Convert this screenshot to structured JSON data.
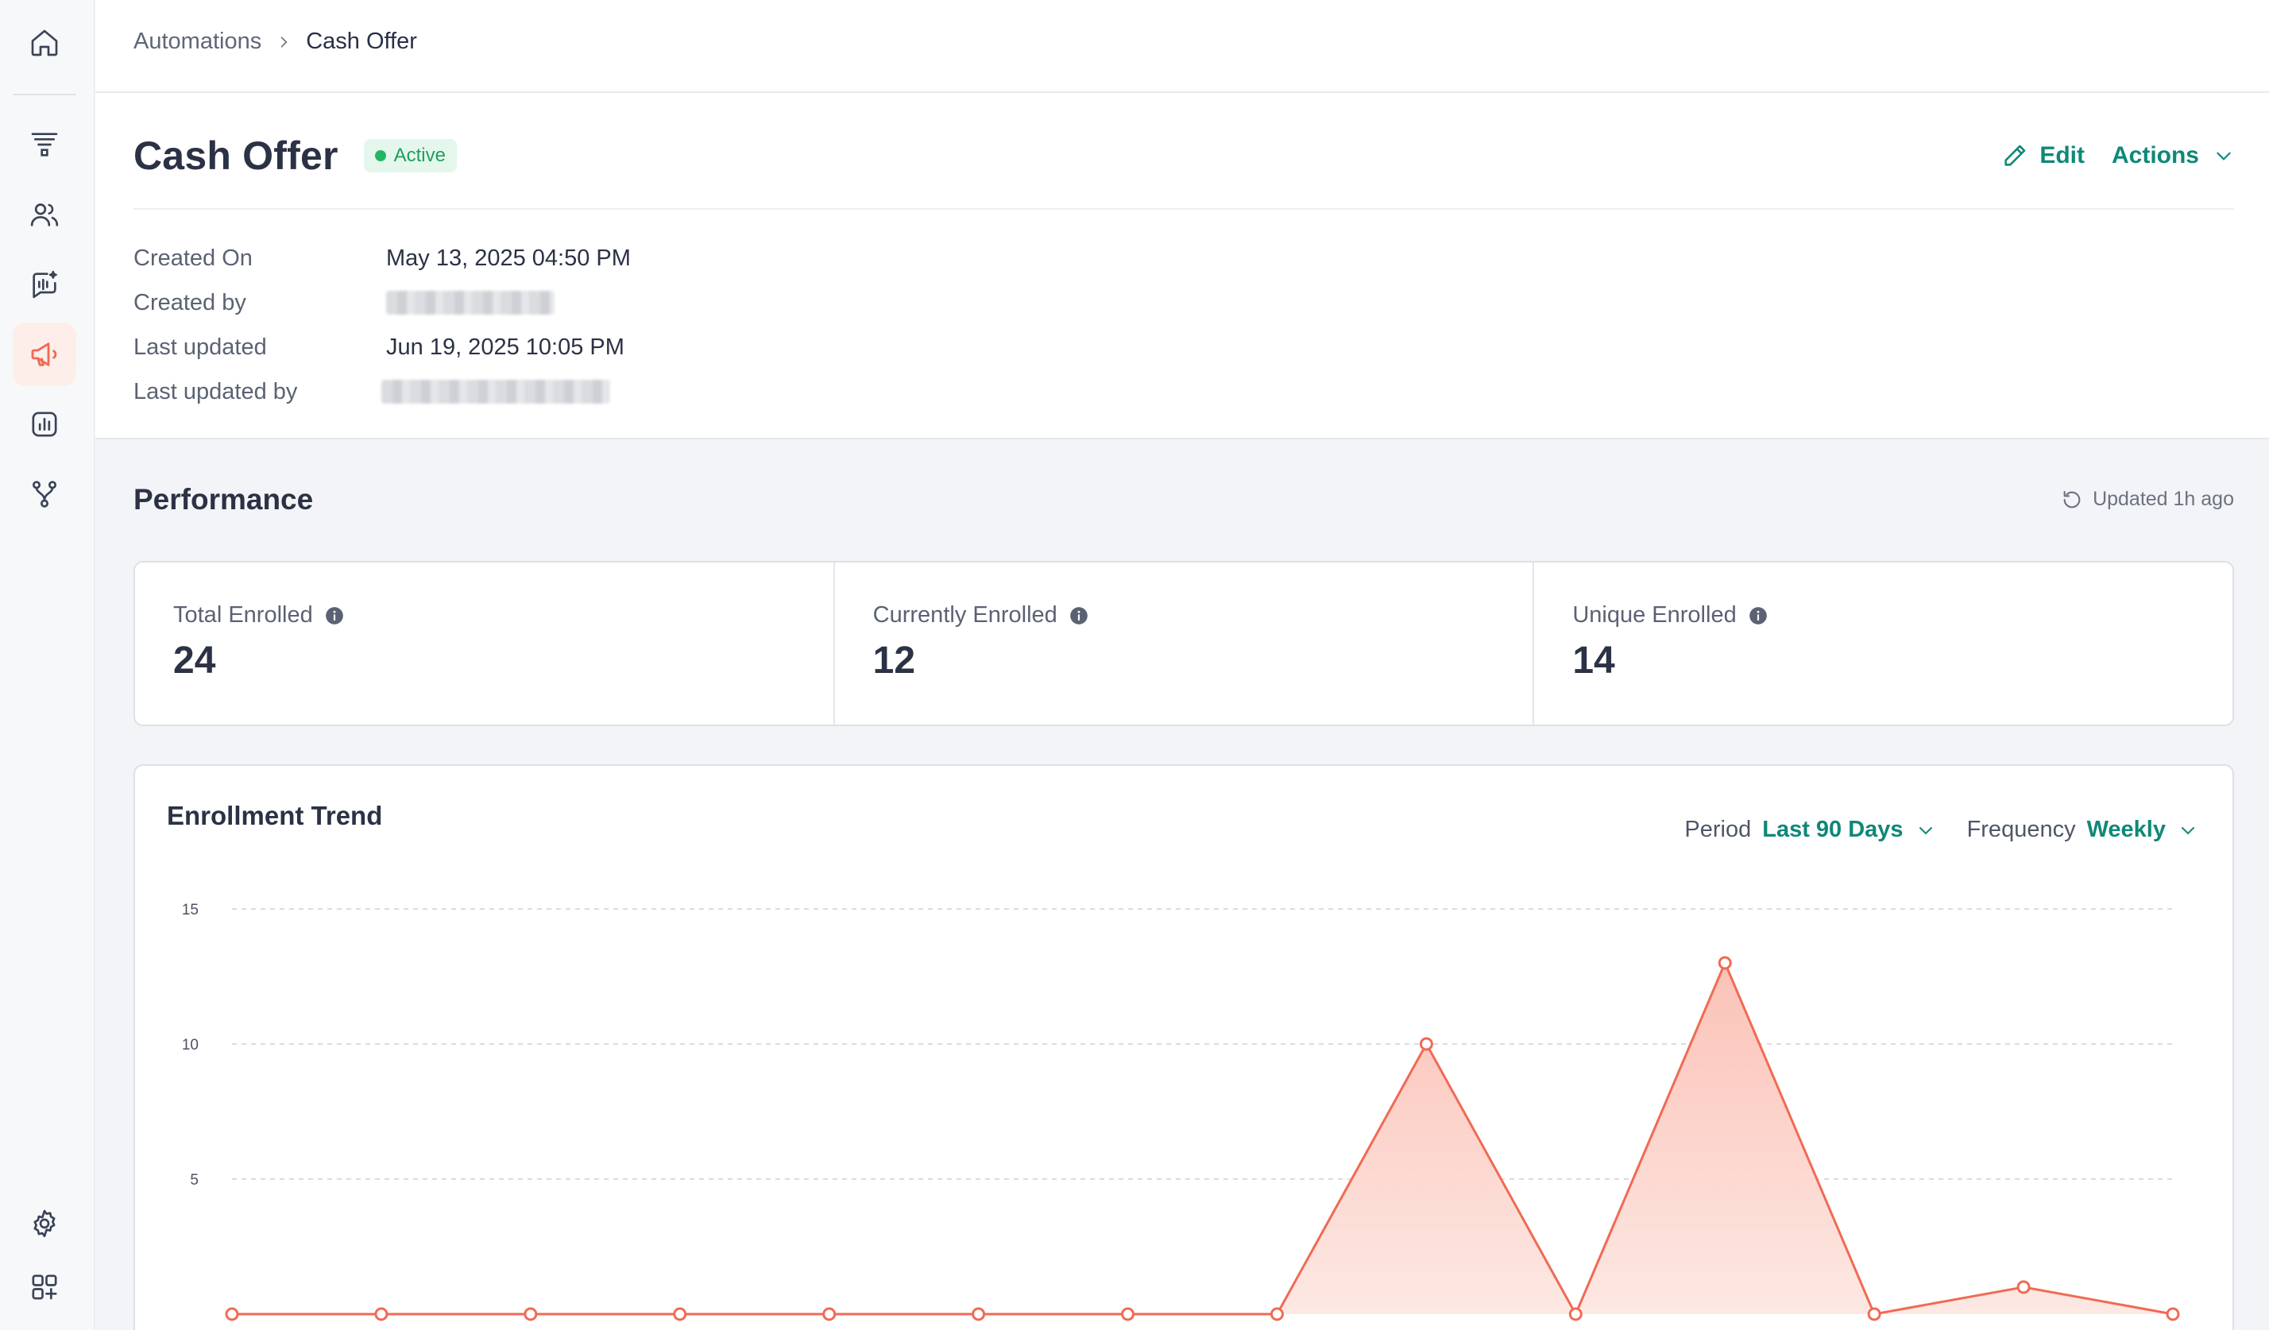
{
  "sidebar": {
    "items": [
      {
        "name": "home",
        "icon": "home-icon",
        "active": false
      },
      {
        "name": "funnel",
        "icon": "funnel-icon",
        "active": false
      },
      {
        "name": "contacts",
        "icon": "users-icon",
        "active": false
      },
      {
        "name": "conversations",
        "icon": "chat-voice-icon",
        "active": false
      },
      {
        "name": "campaigns",
        "icon": "megaphone-icon",
        "active": true
      },
      {
        "name": "reports",
        "icon": "bar-chart-icon",
        "active": false
      },
      {
        "name": "automations",
        "icon": "workflow-icon",
        "active": false
      }
    ],
    "bottom": [
      {
        "name": "settings",
        "icon": "gear-icon"
      },
      {
        "name": "apps",
        "icon": "apps-add-icon"
      }
    ]
  },
  "breadcrumb": {
    "parent": "Automations",
    "current": "Cash Offer"
  },
  "header": {
    "title": "Cash Offer",
    "status": "Active",
    "edit_label": "Edit",
    "actions_label": "Actions"
  },
  "meta": {
    "created_on_label": "Created On",
    "created_on_value": "May 13, 2025 04:50 PM",
    "created_by_label": "Created by",
    "last_updated_label": "Last updated",
    "last_updated_value": "Jun 19, 2025 10:05 PM",
    "last_updated_by_label": "Last updated by"
  },
  "performance": {
    "title": "Performance",
    "updated": "Updated 1h ago",
    "stats": [
      {
        "label": "Total Enrolled",
        "value": "24"
      },
      {
        "label": "Currently Enrolled",
        "value": "12"
      },
      {
        "label": "Unique Enrolled",
        "value": "14"
      }
    ]
  },
  "trend": {
    "title": "Enrollment Trend",
    "period_label": "Period",
    "period_value": "Last 90 Days",
    "frequency_label": "Frequency",
    "frequency_value": "Weekly"
  },
  "colors": {
    "accent": "#0f8877",
    "line": "#f06a54",
    "area": "#fcd6cf",
    "active_badge_bg": "#e5f7ec",
    "active_badge_text": "#1f9e5a"
  },
  "chart_data": {
    "type": "area",
    "title": "",
    "xlabel": "",
    "ylabel": "",
    "ylim": [
      0,
      15
    ],
    "yticks": [
      5,
      10,
      15
    ],
    "grid": true,
    "series": [
      {
        "values": [
          0,
          0,
          0,
          0,
          0,
          0,
          0,
          0,
          10,
          0,
          13,
          0,
          1,
          0
        ]
      }
    ]
  }
}
